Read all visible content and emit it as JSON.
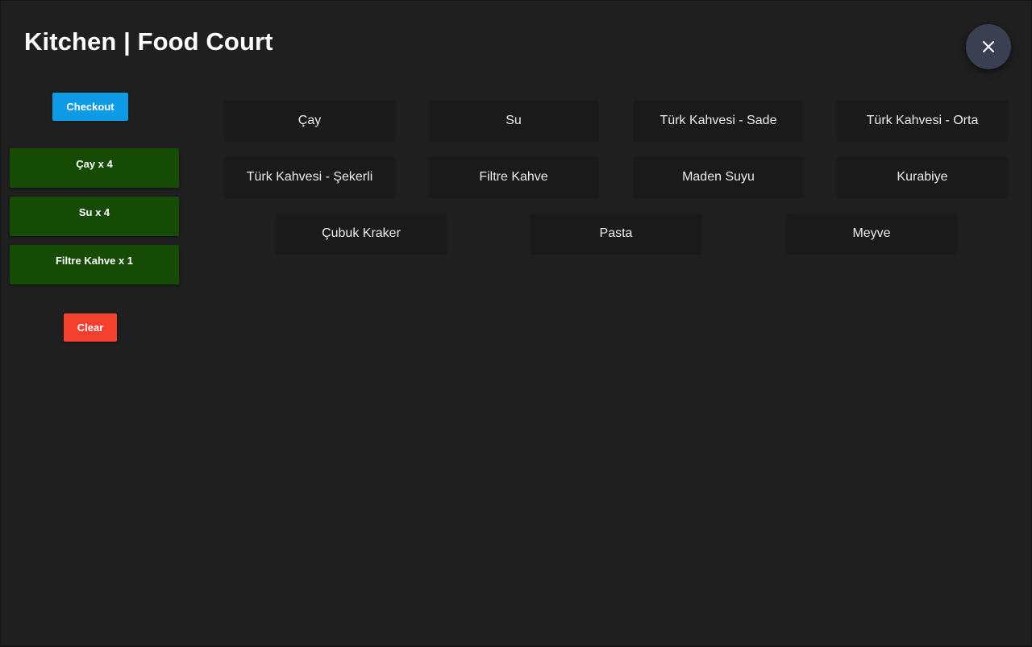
{
  "header": {
    "title": "Kitchen | Food Court"
  },
  "close_button": {
    "icon": "close-icon"
  },
  "sidebar": {
    "checkout_label": "Checkout",
    "clear_label": "Clear",
    "order_items": [
      {
        "label": "Çay x 4"
      },
      {
        "label": "Su x 4"
      },
      {
        "label": "Filtre Kahve x 1"
      }
    ]
  },
  "products": [
    {
      "label": "Çay"
    },
    {
      "label": "Su"
    },
    {
      "label": "Türk Kahvesi - Sade"
    },
    {
      "label": "Türk Kahvesi - Orta"
    },
    {
      "label": "Türk Kahvesi - Şekerli"
    },
    {
      "label": "Filtre Kahve"
    },
    {
      "label": "Maden Suyu"
    },
    {
      "label": "Kurabiye"
    },
    {
      "label": "Çubuk Kraker"
    },
    {
      "label": "Pasta"
    },
    {
      "label": "Meyve"
    }
  ],
  "colors": {
    "background": "#1f1f1f",
    "checkout": "#0d9be6",
    "order_item": "#154b05",
    "clear": "#f4402e",
    "product_button": "#1a1a1a",
    "close_button": "#3a4052"
  }
}
